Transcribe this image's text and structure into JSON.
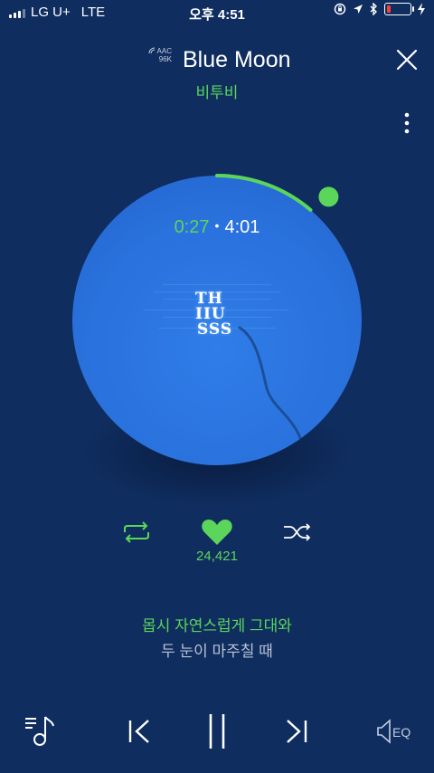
{
  "status": {
    "carrier": "LG U+",
    "network": "LTE",
    "time": "오후 4:51",
    "battery_level": 0.15
  },
  "header": {
    "codec_line1": "AAC",
    "codec_line2": "96K",
    "title": "Blue Moon",
    "artist": "비투비"
  },
  "player": {
    "elapsed": "0:27",
    "separator": "•",
    "total": "4:01",
    "progress": 0.112,
    "album_art_text": [
      "TH",
      "IIU",
      "SSS"
    ]
  },
  "actions": {
    "like_count": "24,421"
  },
  "lyrics": {
    "current": "몹시 자연스럽게 그대와",
    "next": "두 눈이 마주칠 때"
  },
  "bottom": {
    "eq_label": "EQ"
  },
  "colors": {
    "background": "#0f2d5f",
    "accent": "#5bd65b",
    "disc": "#2a72dd"
  },
  "icons": [
    "close-icon",
    "more-vertical-icon",
    "repeat-icon",
    "heart-icon",
    "shuffle-icon",
    "playlist-icon",
    "previous-icon",
    "pause-icon",
    "next-icon",
    "equalizer-icon"
  ]
}
